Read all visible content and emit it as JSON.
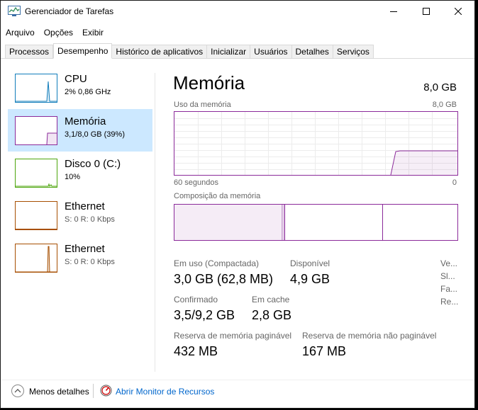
{
  "window": {
    "title": "Gerenciador de Tarefas",
    "controls": [
      "minimize",
      "maximize",
      "close"
    ]
  },
  "menu": [
    "Arquivo",
    "Opções",
    "Exibir"
  ],
  "tabs": [
    {
      "label": "Processos",
      "active": false
    },
    {
      "label": "Desempenho",
      "active": true
    },
    {
      "label": "Histórico de aplicativos",
      "active": false
    },
    {
      "label": "Inicializar",
      "active": false
    },
    {
      "label": "Usuários",
      "active": false
    },
    {
      "label": "Detalhes",
      "active": false
    },
    {
      "label": "Serviços",
      "active": false
    }
  ],
  "sidebar": {
    "items": [
      {
        "name": "CPU",
        "sub": "2% 0,86 GHz",
        "color": "#117dbb"
      },
      {
        "name": "Memória",
        "sub": "3,1/8,0 GB (39%)",
        "color": "#8b2a9a",
        "selected": true
      },
      {
        "name": "Disco 0 (C:)",
        "sub": "10%",
        "color": "#4da60c"
      },
      {
        "name": "Ethernet",
        "sub": "S: 0 R: 0 Kbps",
        "color": "#a74f01"
      },
      {
        "name": "Ethernet",
        "sub": "S: 0 R: 0 Kbps",
        "color": "#a74f01"
      }
    ]
  },
  "main": {
    "title": "Memória",
    "total": "8,0 GB",
    "usage_label": "Uso da memória",
    "usage_max": "8,0 GB",
    "time_left": "60 segundos",
    "time_right": "0",
    "composition_label": "Composição da memória",
    "stats": {
      "in_use_label": "Em uso (Compactada)",
      "in_use_value": "3,0 GB (62,8 MB)",
      "available_label": "Disponível",
      "available_value": "4,9 GB",
      "committed_label": "Confirmado",
      "committed_value": "3,5/9,2 GB",
      "cached_label": "Em cache",
      "cached_value": "2,8 GB",
      "paged_label": "Reserva de memória paginável",
      "paged_value": "432 MB",
      "nonpaged_label": "Reserva de memória não paginável",
      "nonpaged_value": "167 MB"
    },
    "right_truncated": [
      "Ve...",
      "Sl...",
      "Fa...",
      "Re..."
    ]
  },
  "footer": {
    "less_details": "Menos detalhes",
    "resource_monitor": "Abrir Monitor de Recursos"
  },
  "colors": {
    "memory": "#8b2a9a",
    "selected_bg": "#cce8ff",
    "link": "#0066cc"
  }
}
